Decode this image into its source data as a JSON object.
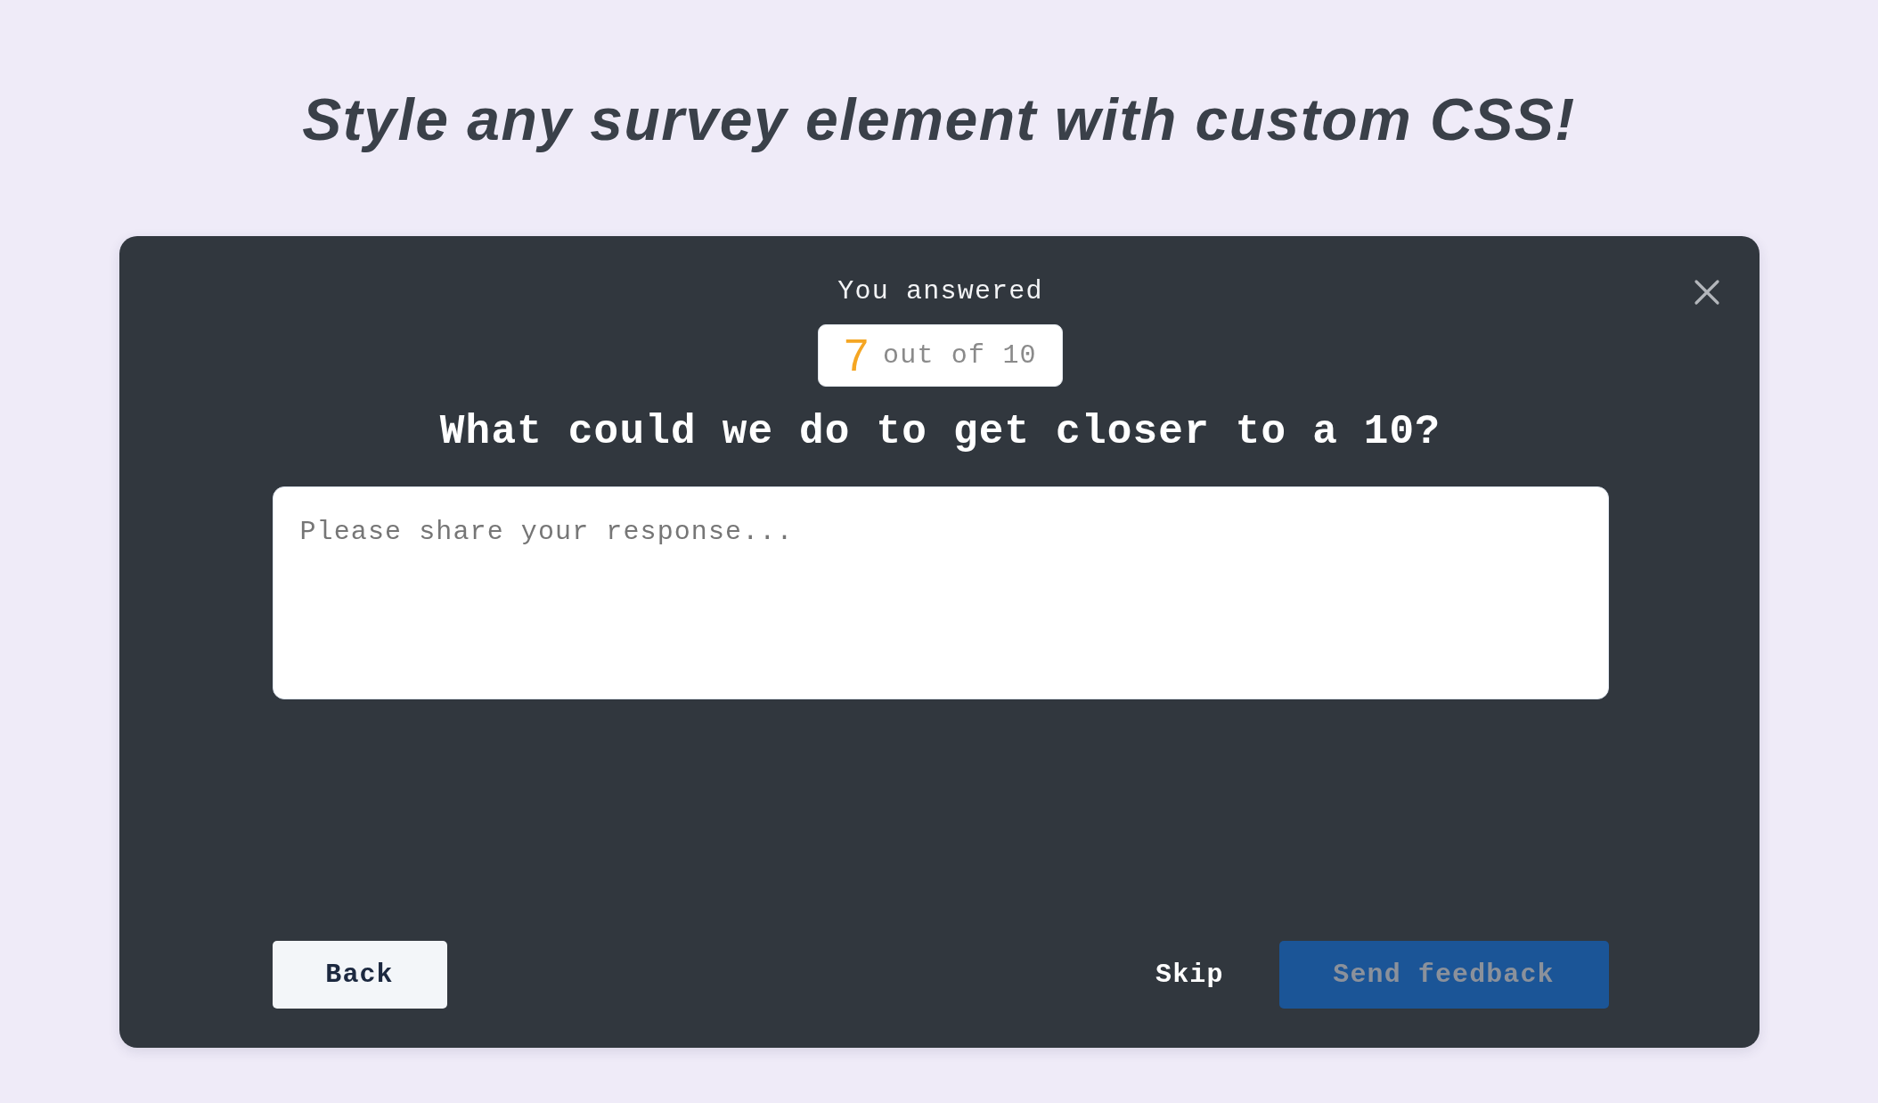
{
  "heading": "Style any survey element with custom CSS!",
  "survey": {
    "answered_label": "You answered",
    "score": {
      "value": "7",
      "suffix": "out of 10"
    },
    "question": "What could we do to get closer to a 10?",
    "response": {
      "placeholder": "Please share your response..."
    },
    "buttons": [
      {
        "label": "Back",
        "kind": "secondary",
        "disabled": false
      },
      {
        "label": "Skip",
        "kind": "link",
        "disabled": false
      },
      {
        "label": "Send feedback",
        "kind": "primary",
        "disabled": true
      }
    ]
  }
}
